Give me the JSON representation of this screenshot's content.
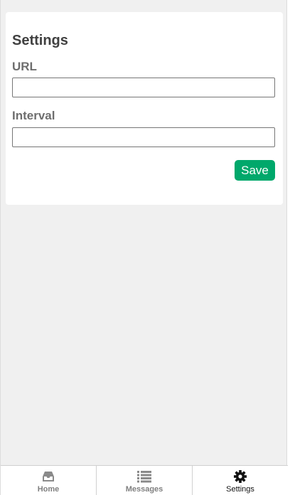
{
  "settings_card": {
    "title": "Settings",
    "url_field": {
      "label": "URL",
      "value": "",
      "placeholder": ""
    },
    "interval_field": {
      "label": "Interval",
      "value": "",
      "placeholder": ""
    },
    "save_label": "Save",
    "save_color": "#00a86b"
  },
  "tab_bar": {
    "active_tab": "Settings",
    "tabs": [
      {
        "label": "Home",
        "icon": "inbox-icon"
      },
      {
        "label": "Messages",
        "icon": "list-icon"
      },
      {
        "label": "Settings",
        "icon": "gear-icon"
      }
    ]
  }
}
